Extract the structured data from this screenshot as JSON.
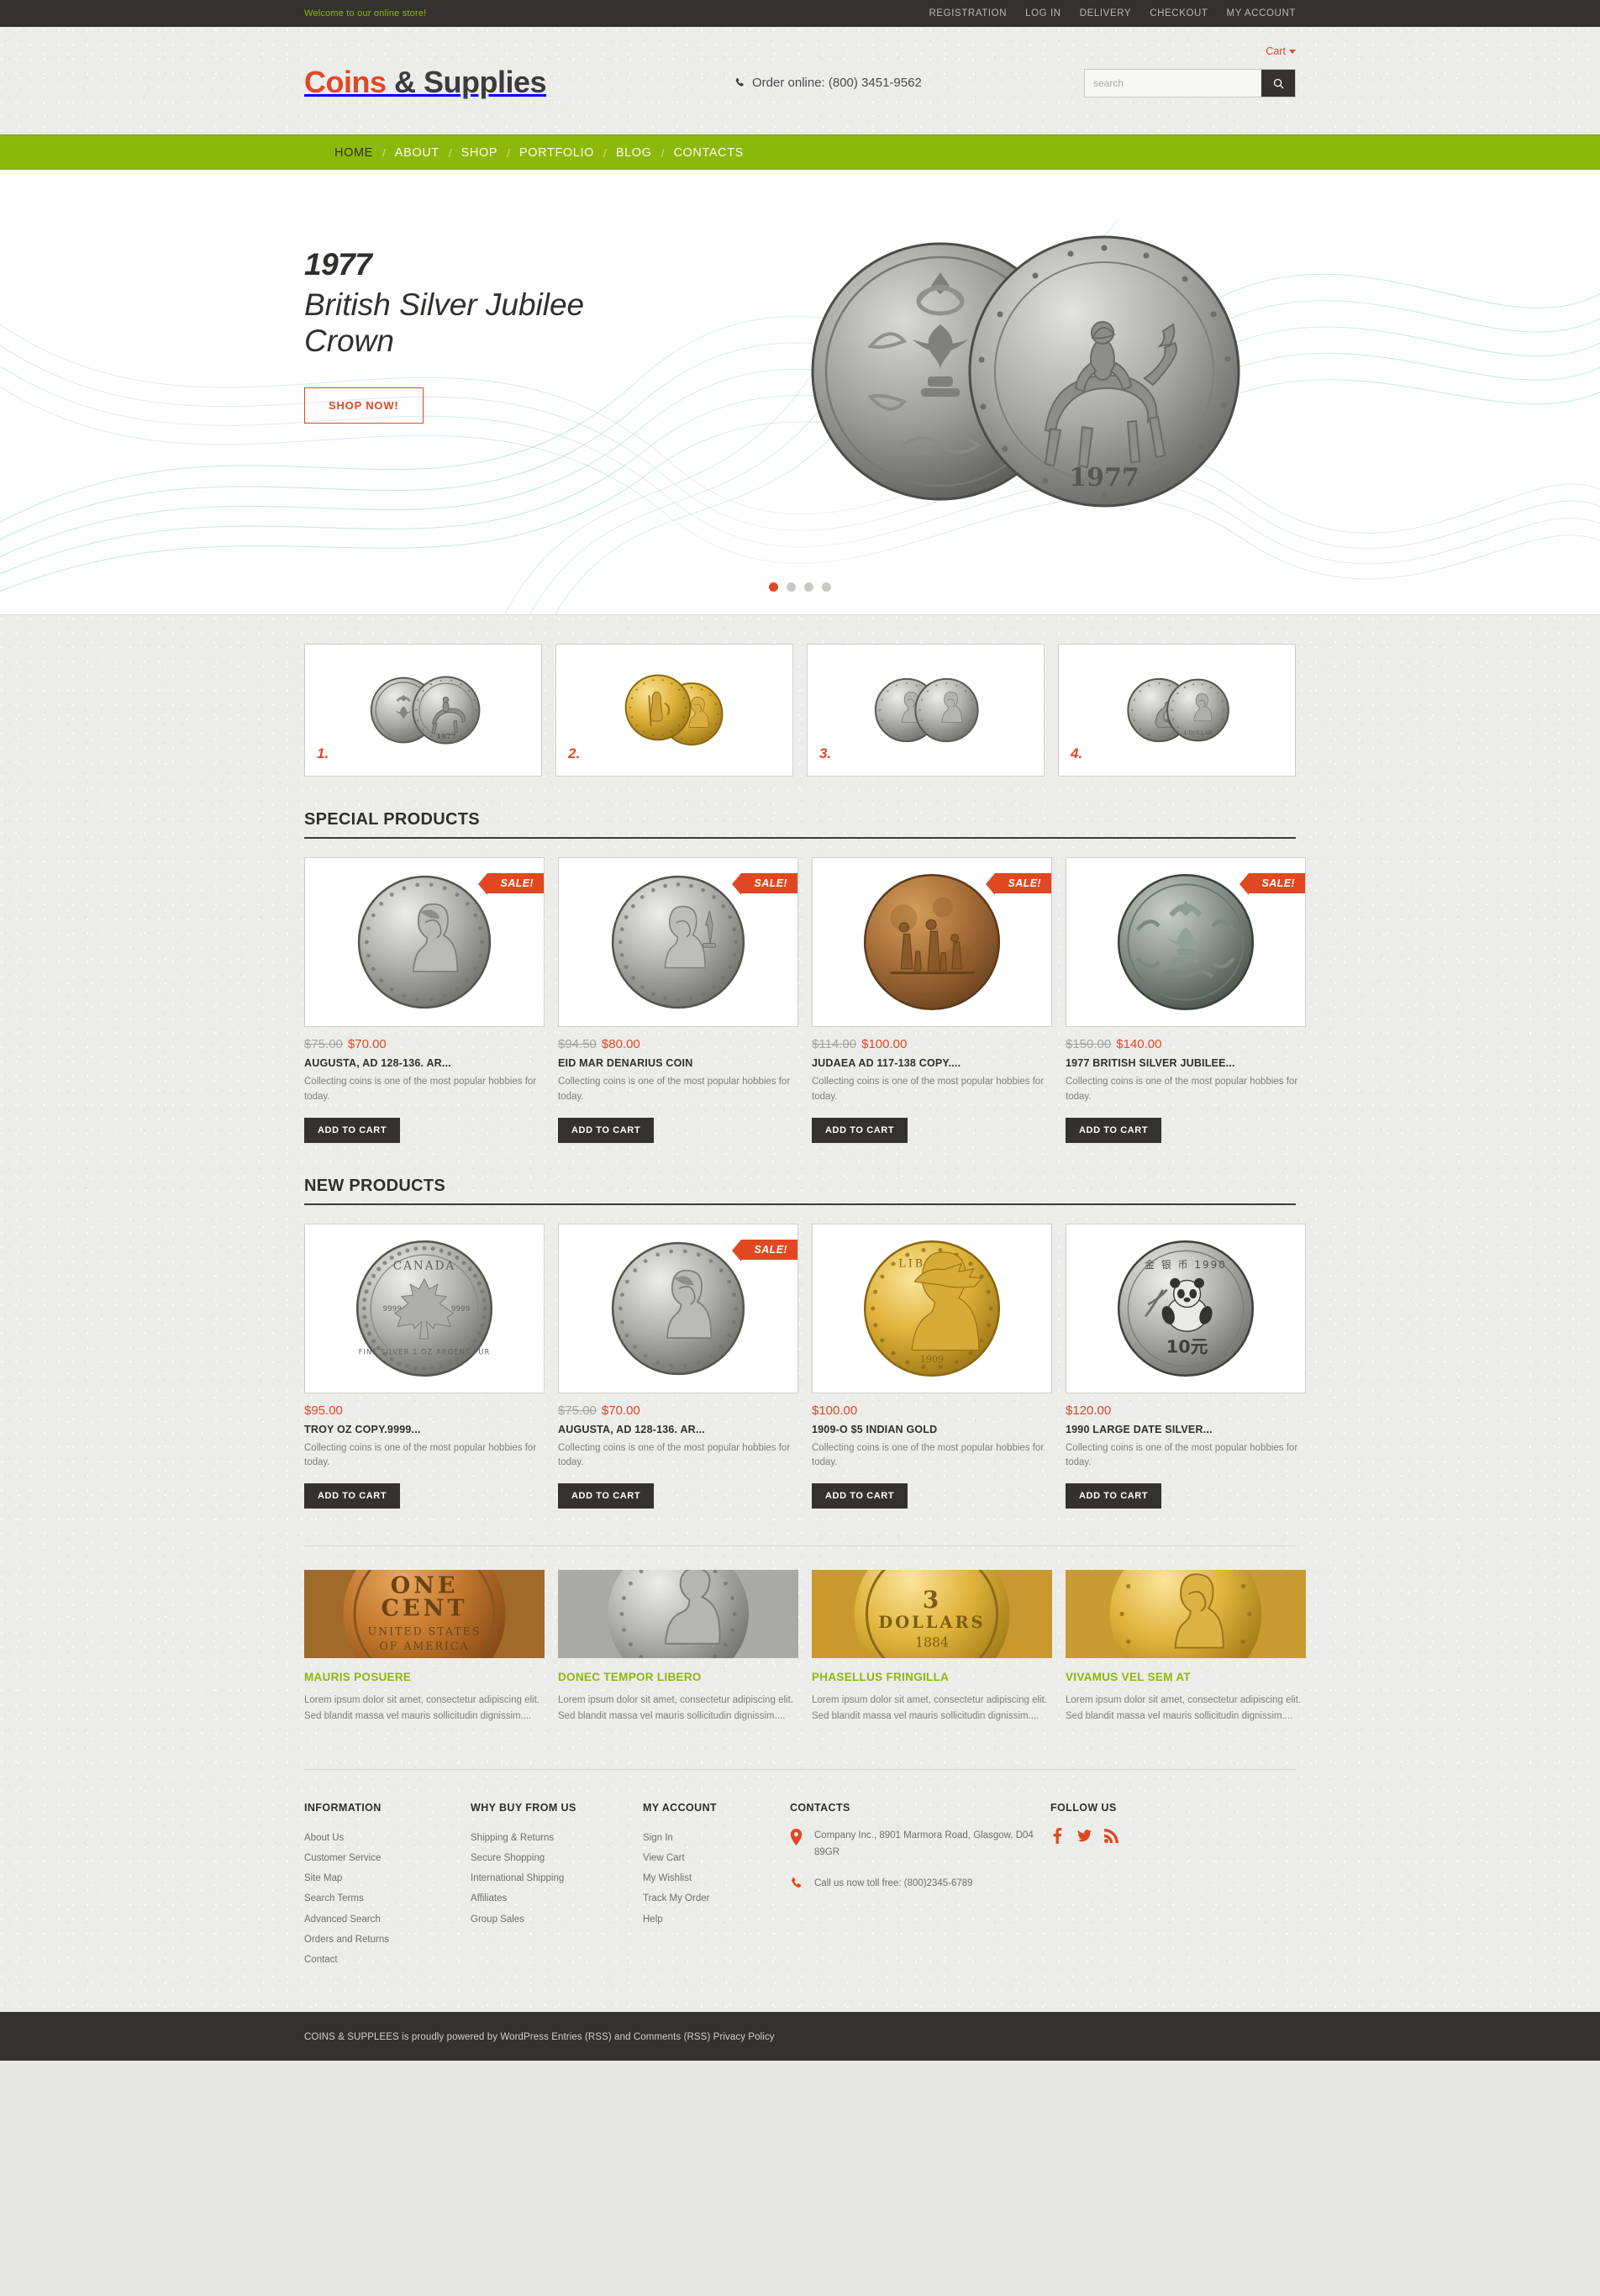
{
  "topbar": {
    "welcome": "Welcome to our online store!",
    "links": [
      {
        "label": "REGISTRATION"
      },
      {
        "label": "LOG IN"
      },
      {
        "label": "DELIVERY"
      },
      {
        "label": "CHECKOUT"
      },
      {
        "label": "MY ACCOUNT"
      }
    ]
  },
  "header": {
    "logo_part1": "Coins",
    "logo_part2": " & Supplies",
    "cart_label": "Cart",
    "phone": "Order online: (800) 3451-9562",
    "search_placeholder": "search",
    "search_value": ""
  },
  "nav": {
    "items": [
      {
        "label": "HOME",
        "active": true
      },
      {
        "label": "ABOUT",
        "active": false
      },
      {
        "label": "SHOP",
        "active": false
      },
      {
        "label": "PORTFOLIO",
        "active": false
      },
      {
        "label": "BLOG",
        "active": false
      },
      {
        "label": "CONTACTS",
        "active": false
      }
    ],
    "separator": "/"
  },
  "slider": {
    "year": "1977",
    "title": "British Silver Jubilee Crown",
    "button": "SHOP NOW!",
    "dots": [
      {
        "active": true
      },
      {
        "active": false
      },
      {
        "active": false
      },
      {
        "active": false
      }
    ]
  },
  "thumbs": [
    {
      "num": "1.",
      "kind": "silver-jubilee-crown"
    },
    {
      "num": "2.",
      "kind": "gold-britannia"
    },
    {
      "num": "3.",
      "kind": "silver-portrait-pair"
    },
    {
      "num": "4.",
      "kind": "australian-silver-kangaroo"
    }
  ],
  "special": {
    "heading": "SPECIAL PRODUCTS",
    "products": [
      {
        "sale": true,
        "sale_label": "SALE!",
        "old_price": "$75.00",
        "price": "$70.00",
        "name": "AUGUSTA, AD 128-136. AR...",
        "desc": "Collecting coins is one of the most popular hobbies for today.",
        "button": "ADD TO CART",
        "coin": "sabina-silver"
      },
      {
        "sale": true,
        "sale_label": "SALE!",
        "old_price": "$94.50",
        "price": "$80.00",
        "name": "EID MAR DENARIUS COIN",
        "desc": "Collecting coins is one of the most popular hobbies for today.",
        "button": "ADD TO CART",
        "coin": "eid-mar-silver"
      },
      {
        "sale": true,
        "sale_label": "SALE!",
        "old_price": "$114.00",
        "price": "$100.00",
        "name": "JUDAEA AD 117-138 COPY....",
        "desc": "Collecting coins is one of the most popular hobbies for today.",
        "button": "ADD TO CART",
        "coin": "judaea-bronze"
      },
      {
        "sale": true,
        "sale_label": "SALE!",
        "old_price": "$150.00",
        "price": "$140.00",
        "name": "1977 BRITISH SILVER JUBILEE...",
        "desc": "Collecting coins is one of the most popular hobbies for today.",
        "button": "ADD TO CART",
        "coin": "jubilee-crown-dark"
      }
    ]
  },
  "newproducts": {
    "heading": "NEW PRODUCTS",
    "products": [
      {
        "sale": false,
        "sale_label": "",
        "old_price": "",
        "price": "$95.00",
        "name": "TROY OZ COPY.9999...",
        "desc": "Collecting coins is one of the most popular hobbies for today.",
        "button": "ADD TO CART",
        "coin": "canada-maple-silver"
      },
      {
        "sale": true,
        "sale_label": "SALE!",
        "old_price": "$75.00",
        "price": "$70.00",
        "name": "AUGUSTA, AD 128-136. AR...",
        "desc": "Collecting coins is one of the most popular hobbies for today.",
        "button": "ADD TO CART",
        "coin": "sabina-silver"
      },
      {
        "sale": false,
        "sale_label": "",
        "old_price": "",
        "price": "$100.00",
        "name": "1909-O $5 INDIAN GOLD",
        "desc": "Collecting coins is one of the most popular hobbies for today.",
        "button": "ADD TO CART",
        "coin": "indian-head-gold"
      },
      {
        "sale": false,
        "sale_label": "",
        "old_price": "",
        "price": "$120.00",
        "name": "1990 LARGE DATE SILVER...",
        "desc": "Collecting coins is one of the most popular hobbies for today.",
        "button": "ADD TO CART",
        "coin": "panda-silver"
      }
    ]
  },
  "posts": [
    {
      "title": "MAURIS POSUERE",
      "text": "Lorem ipsum dolor sit amet, consectetur adipiscing elit. Sed blandit massa vel mauris sollicitudin dignissim....",
      "image": "one-cent-copper"
    },
    {
      "title": "DONEC TEMPOR LIBERO",
      "text": "Lorem ipsum dolor sit amet, consectetur adipiscing elit. Sed blandit massa vel mauris sollicitudin dignissim....",
      "image": "seated-liberty-silver"
    },
    {
      "title": "PHASELLUS FRINGILLA",
      "text": "Lorem ipsum dolor sit amet, consectetur adipiscing elit. Sed blandit massa vel mauris sollicitudin dignissim....",
      "image": "three-dollars-gold"
    },
    {
      "title": "VIVAMUS VEL SEM AT",
      "text": "Lorem ipsum dolor sit amet, consectetur adipiscing elit. Sed blandit massa vel mauris sollicitudin dignissim....",
      "image": "liberty-head-gold"
    }
  ],
  "footer": {
    "information": {
      "heading": "INFORMATION",
      "links": [
        {
          "label": "About Us"
        },
        {
          "label": "Customer Service"
        },
        {
          "label": "Site Map"
        },
        {
          "label": "Search Terms"
        },
        {
          "label": "Advanced Search"
        },
        {
          "label": "Orders and Returns"
        },
        {
          "label": "Contact"
        }
      ]
    },
    "why": {
      "heading": "WHY BUY FROM US",
      "links": [
        {
          "label": "Shipping & Returns"
        },
        {
          "label": "Secure Shopping"
        },
        {
          "label": "International Shipping"
        },
        {
          "label": "Affiliates"
        },
        {
          "label": "Group Sales"
        }
      ]
    },
    "account": {
      "heading": "MY ACCOUNT",
      "links": [
        {
          "label": "Sign In"
        },
        {
          "label": "View Cart"
        },
        {
          "label": "My Wishlist"
        },
        {
          "label": "Track My Order"
        },
        {
          "label": "Help"
        }
      ]
    },
    "contacts": {
      "heading": "CONTACTS",
      "address": "Company Inc., 8901 Marmora Road, Glasgow, D04 89GR",
      "phone": "Call us now toll free: (800)2345-6789"
    },
    "follow": {
      "heading": "FOLLOW US",
      "socials": [
        {
          "name": "facebook"
        },
        {
          "name": "twitter"
        },
        {
          "name": "rss"
        }
      ]
    }
  },
  "copyright": "COINS & SUPPLEES is proudly powered by WordPress Entries (RSS) and Comments (RSS) Privacy Policy",
  "colors": {
    "accent_orange": "#e04822",
    "accent_green": "#8cb80b",
    "dark": "#333230"
  }
}
